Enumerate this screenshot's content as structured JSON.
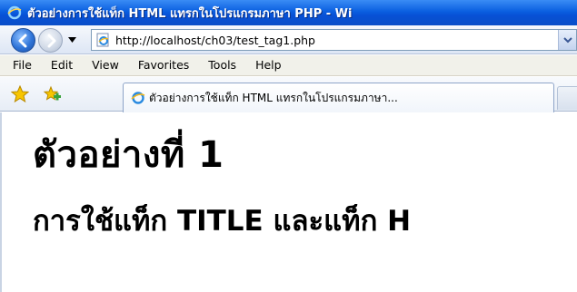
{
  "window": {
    "title": "ตัวอย่างการใช้แท็ก HTML แทรกในโปรแกรมภาษา PHP - Wi"
  },
  "address_bar": {
    "url": "http://localhost/ch03/test_tag1.php"
  },
  "menu": {
    "items": [
      "File",
      "Edit",
      "View",
      "Favorites",
      "Tools",
      "Help"
    ]
  },
  "tab": {
    "label": "ตัวอย่างการใช้แท็ก HTML แทรกในโปรแกรมภาษา..."
  },
  "page": {
    "heading1": "ตัวอย่างที่ 1",
    "heading2": "การใช้แท็ก TITLE และแท็ก H"
  },
  "icons": {
    "back": "back-arrow-icon",
    "forward": "forward-arrow-icon",
    "favorites": "star-icon",
    "add_favorite": "add-star-icon",
    "browser": "ie-icon"
  },
  "colors": {
    "titlebar": "#0a5fe0",
    "back_button": "#2f74d8"
  }
}
